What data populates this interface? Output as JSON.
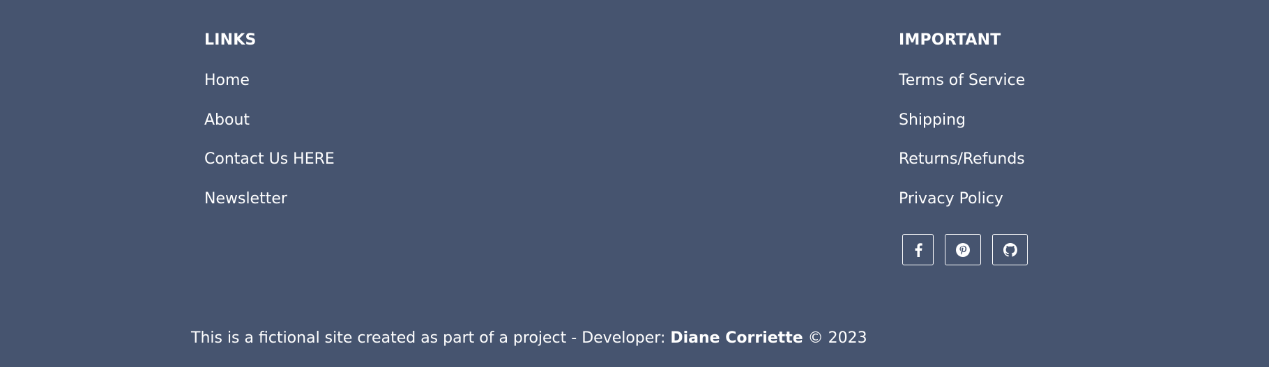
{
  "links": {
    "heading": "LINKS",
    "items": [
      {
        "label": "Home"
      },
      {
        "label": "About"
      },
      {
        "label": "Contact Us HERE"
      },
      {
        "label": "Newsletter"
      }
    ]
  },
  "important": {
    "heading": "IMPORTANT",
    "items": [
      {
        "label": "Terms of Service"
      },
      {
        "label": "Shipping"
      },
      {
        "label": "Returns/Refunds"
      },
      {
        "label": "Privacy Policy"
      }
    ]
  },
  "social": [
    {
      "icon": "facebook-icon"
    },
    {
      "icon": "pinterest-icon"
    },
    {
      "icon": "github-icon"
    }
  ],
  "footer": {
    "text_before": "This is a fictional site created as part of a project - Developer: ",
    "developer": "Diane Corriette",
    "text_after": " © 2023"
  },
  "colors": {
    "background": "#46546f",
    "text": "#ffffff"
  }
}
